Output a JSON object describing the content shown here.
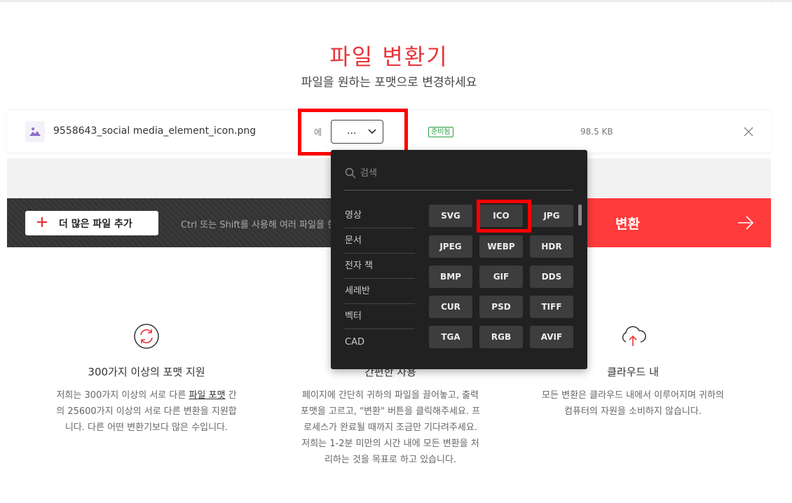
{
  "header": {
    "title": "파일 변환기",
    "subtitle": "파일을 원하는 포맷으로 변경하세요"
  },
  "file": {
    "name": "9558643_social media_element_icon.png",
    "to_label": "에",
    "selected_format": "...",
    "status": "준비됨",
    "size": "98.5 KB",
    "status_color": "#2ea043"
  },
  "actions": {
    "add_files_label": "더 많은 파일 추가",
    "hint": "Ctrl 또는 Shift를 사용해 여러 파일을 한",
    "convert_label": "변환",
    "accent": "#ff3b3b"
  },
  "dropdown": {
    "search_placeholder": "검색",
    "categories": [
      "영상",
      "문서",
      "전자 책",
      "세레반",
      "벡터",
      "CAD"
    ],
    "formats": [
      [
        "SVG",
        "ICO",
        "JPG"
      ],
      [
        "JPEG",
        "WEBP",
        "HDR"
      ],
      [
        "BMP",
        "GIF",
        "DDS"
      ],
      [
        "CUR",
        "PSD",
        "TIFF"
      ],
      [
        "TGA",
        "RGB",
        "AVIF"
      ]
    ]
  },
  "features": [
    {
      "icon": "refresh-icon",
      "title": "300가지 이상의 포맷 지원",
      "desc_pre": "저희는 300가지 이상의 서로 다른 ",
      "desc_link": "파일 포맷",
      "desc_post": " 간의 25600가지 이상의 서로 다른 변환을 지원합니다. 다른 어떤 변환기보다 많은 수입니다."
    },
    {
      "icon": "cursor-icon",
      "title": "간편한 사용",
      "desc": "페이지에 간단히 귀하의 파일을 끌어놓고, 출력 포맷을 고르고, \"변환\" 버튼을 클릭해주세요. 프로세스가 완료될 때까지 조금만 기다려주세요. 저희는 1-2분 미만의 시간 내에 모든 변환을 처리하는 것을 목표로 하고 있습니다."
    },
    {
      "icon": "cloud-upload-icon",
      "title": "클라우드 내",
      "desc": "모든 변환은 클라우드 내에서 이루어지며 귀하의 컴퓨터의 자원을 소비하지 않습니다."
    }
  ]
}
